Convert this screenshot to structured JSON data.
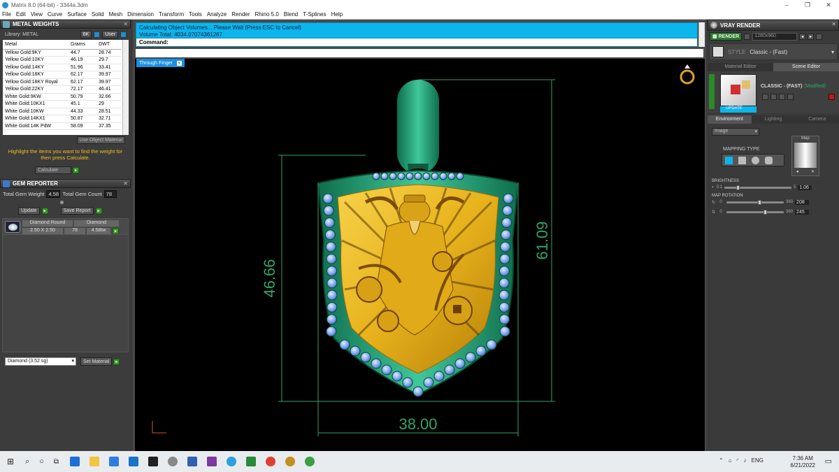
{
  "window": {
    "title": "Matrix 8.0 (64-bit) - 3344a.3dm",
    "controls": [
      "–",
      "❐",
      "✕"
    ]
  },
  "menu": [
    "File",
    "Edit",
    "View",
    "Curve",
    "Surface",
    "Solid",
    "Mesh",
    "Dimension",
    "Transform",
    "Tools",
    "Analyze",
    "Render",
    "Rhino 5.0",
    "Blend",
    "T-Splines",
    "Help"
  ],
  "metal_weights": {
    "title": "METAL WEIGHTS",
    "library_label": "Library: METAL",
    "mode_a": "6K",
    "mode_b": "User",
    "columns": [
      "Metal",
      "Grams",
      "DWT"
    ],
    "rows": [
      [
        "Yellow Gold:9KY",
        "44.7",
        "28.74"
      ],
      [
        "Yellow Gold:10KY",
        "46.19",
        "29.7"
      ],
      [
        "Yellow Gold:14KY",
        "51.96",
        "33.41"
      ],
      [
        "Yellow Gold:18KY",
        "62.17",
        "39.97"
      ],
      [
        "Yellow Gold:18KY Royal",
        "62.17",
        "39.97"
      ],
      [
        "Yellow Gold:22KY",
        "72.17",
        "46.41"
      ],
      [
        "White Gold:9KW",
        "50.79",
        "32.66"
      ],
      [
        "White Gold:10KX1",
        "45.1",
        "29"
      ],
      [
        "White Gold:10KW",
        "44.33",
        "28.51"
      ],
      [
        "White Gold:14KX1",
        "50.87",
        "32.71"
      ],
      [
        "White Gold:14K PdW",
        "58.09",
        "37.35"
      ]
    ],
    "use_object_material": "Use Object Material",
    "hint": "Highlight the items you want to find the weight for then press Calculate.",
    "calculate": "Calculate"
  },
  "gem_reporter": {
    "title": "GEM REPORTER",
    "total_weight_label": "Total Gem Weight",
    "total_weight": "4.58",
    "total_count_label": "Total Gem Count",
    "total_count": "78",
    "update": "Update",
    "save_report": "Save Report",
    "gem": {
      "shape": "Diamond Round",
      "material": "Diamond",
      "size": "2.50 X 2.50",
      "count": "78",
      "weight": "4.58tw"
    }
  },
  "bottom_left": {
    "material_select": "Diamond    (3.52 sg)",
    "set_material": "Set Material"
  },
  "command": {
    "line1": "Calculating Object Volumes... Please Wait (Press ESC to Cancel)",
    "line2": "Volume Total: 4034.07074361267",
    "prompt": "Command:"
  },
  "viewport": {
    "label": "Through Finger",
    "dimensions": {
      "height_outer": "46.66",
      "height_total": "61.09",
      "width": "38.00"
    }
  },
  "vray": {
    "title": "VRAY RENDER",
    "render_btn": "RENDER",
    "resolution": "1280x960",
    "style_label": "STYLE",
    "style_value": "Classic - (Fast)",
    "tabs": [
      "Material Editor",
      "Scene Editor"
    ],
    "preset_name": "CLASSIC - (FAST)",
    "preset_status": "(Modified)",
    "update_btn": "UPDATE",
    "env_tabs": [
      "Environment",
      "Lighting",
      "Camera"
    ],
    "env_select": "Image",
    "mapping_type": "MAPPING TYPE",
    "map_label": "Map",
    "brightness": {
      "label": "BRIGHTNESS",
      "min": "0.1",
      "max": "5",
      "value": "1.06",
      "level": 0.21
    },
    "map_rotation": {
      "label": "MAP ROTATION",
      "min1": "0",
      "max1": "360",
      "value1": "208",
      "level1": 0.58,
      "min2": "0",
      "max2": "360",
      "value2": "245",
      "level2": 0.68
    }
  },
  "taskbar": {
    "lang": "ENG",
    "time": "7:36 AM",
    "date": "6/21/2022"
  },
  "colors": {
    "accent": "#0db5ed",
    "dimension": "#2fa36a",
    "gold": "#e8b820",
    "metal_green": "#1f9d6e",
    "gem": "#7ea6f0",
    "hint": "#f0c020"
  }
}
